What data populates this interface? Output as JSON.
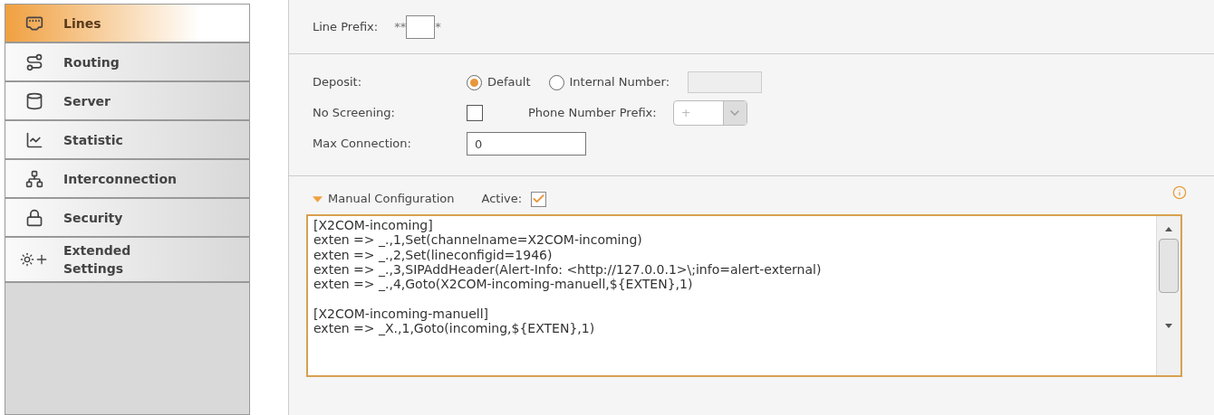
{
  "sidebar": {
    "items": [
      {
        "label": "Lines",
        "selected": true
      },
      {
        "label": "Routing",
        "selected": false
      },
      {
        "label": "Server",
        "selected": false
      },
      {
        "label": "Statistic",
        "selected": false
      },
      {
        "label": "Interconnection",
        "selected": false
      },
      {
        "label": "Security",
        "selected": false
      },
      {
        "label": "Extended Settings",
        "selected": false
      }
    ]
  },
  "line_prefix": {
    "label": "Line Prefix:",
    "before": "**",
    "after": "*"
  },
  "deposit": {
    "label": "Deposit:",
    "options": [
      {
        "label": "Default",
        "selected": true
      },
      {
        "label": "Internal Number:",
        "selected": false
      }
    ]
  },
  "no_screening": {
    "label": "No Screening:",
    "checked": false
  },
  "phone_number_prefix": {
    "label": "Phone Number Prefix:",
    "value": "+"
  },
  "max_connection": {
    "label": "Max Connection:",
    "value": "0"
  },
  "manual_configuration": {
    "title": "Manual Configuration",
    "expanded": true,
    "active_label": "Active:",
    "active": true,
    "code": "[X2COM-incoming]\nexten => _.,1,Set(channelname=X2COM-incoming)\nexten => _.,2,Set(lineconfigid=1946)\nexten => _.,3,SIPAddHeader(Alert-Info: <http://127.0.0.1>\\;info=alert-external)\nexten => _.,4,Goto(X2COM-incoming-manuell,${EXTEN},1)\n\n[X2COM-incoming-manuell]\nexten => _X.,1,Goto(incoming,${EXTEN},1)"
  }
}
